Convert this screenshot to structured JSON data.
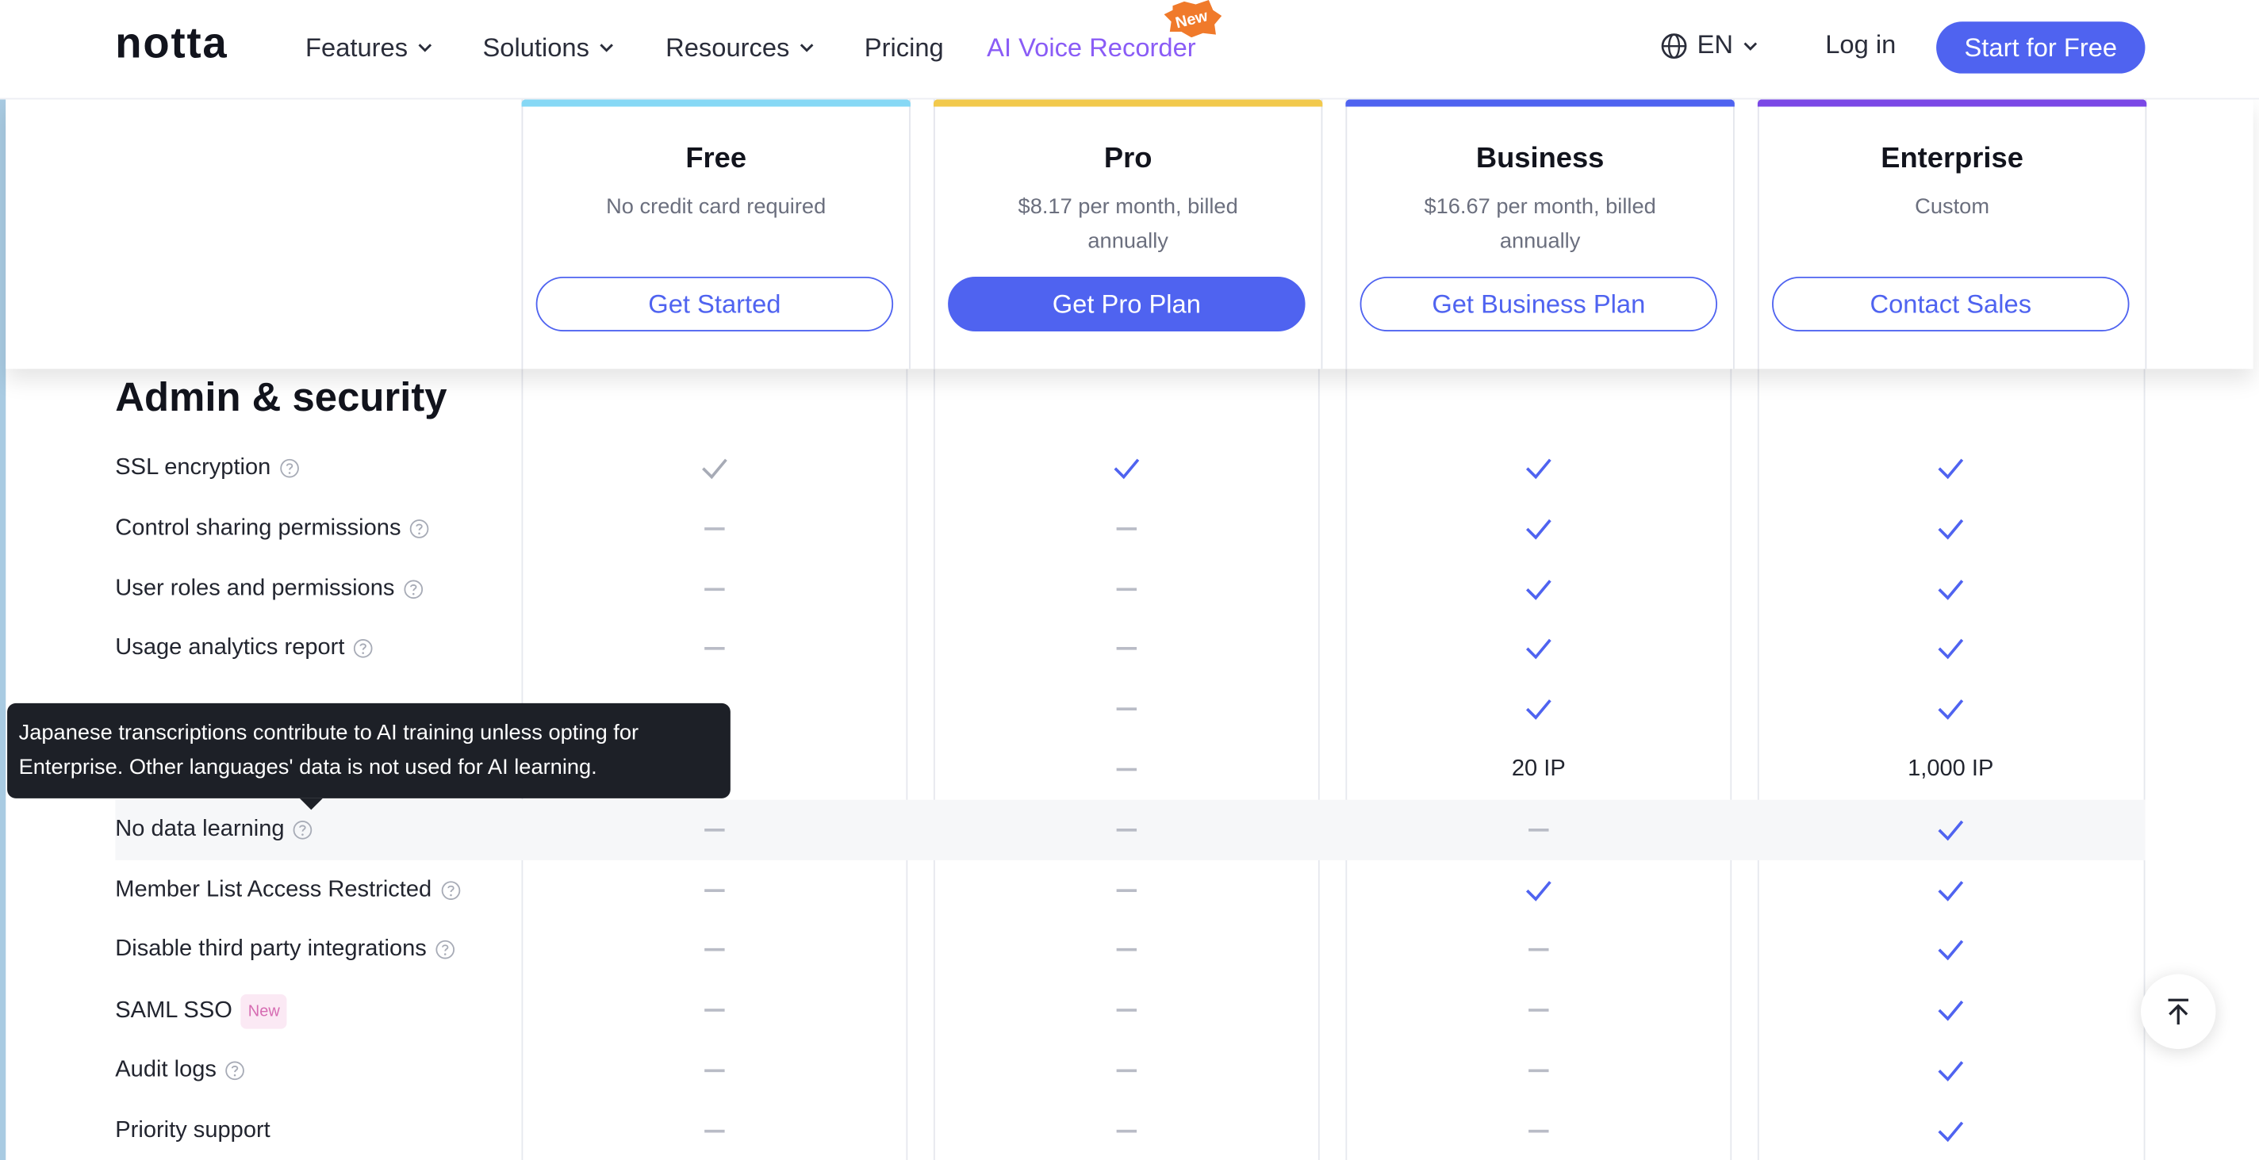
{
  "nav": {
    "logo": "notta",
    "items": [
      {
        "label": "Features",
        "dropdown": true
      },
      {
        "label": "Solutions",
        "dropdown": true
      },
      {
        "label": "Resources",
        "dropdown": true
      },
      {
        "label": "Pricing",
        "dropdown": false
      }
    ],
    "ai_recorder": "AI Voice Recorder",
    "new_badge": "New",
    "language": "EN",
    "login": "Log in",
    "cta": "Start for Free"
  },
  "plans": [
    {
      "name": "Free",
      "subtitle": "No credit card required",
      "button": "Get Started",
      "accent": "#86d8f5",
      "solid": false
    },
    {
      "name": "Pro",
      "subtitle": "$8.17 per month, billed annually",
      "button": "Get Pro Plan",
      "accent": "#f2c94c",
      "solid": true
    },
    {
      "name": "Business",
      "subtitle": "$16.67 per month, billed annually",
      "button": "Get Business Plan",
      "accent": "#4f63f0",
      "solid": false
    },
    {
      "name": "Enterprise",
      "subtitle": "Custom",
      "button": "Contact Sales",
      "accent": "#7b48e6",
      "solid": false
    }
  ],
  "section": {
    "title": "Admin & security",
    "rows": [
      {
        "label": "SSL encryption",
        "help": true,
        "cells": [
          "check-gray",
          "check",
          "check",
          "check"
        ]
      },
      {
        "label": "Control sharing permissions",
        "help": true,
        "cells": [
          "dash",
          "dash",
          "check",
          "check"
        ]
      },
      {
        "label": "User roles and permissions",
        "help": true,
        "cells": [
          "dash",
          "dash",
          "check",
          "check"
        ]
      },
      {
        "label": "Usage analytics report",
        "help": true,
        "cells": [
          "dash",
          "dash",
          "check",
          "check"
        ]
      },
      {
        "label": "",
        "help": false,
        "cells": [
          "",
          "dash",
          "check",
          "check"
        ]
      },
      {
        "label": "",
        "help": false,
        "cells": [
          "",
          "dash",
          "20 IP",
          "1,000 IP"
        ]
      },
      {
        "label": "No data learning",
        "help": true,
        "highlight": true,
        "cells": [
          "dash",
          "dash",
          "dash",
          "check"
        ]
      },
      {
        "label": "Member List Access Restricted",
        "help": true,
        "cells": [
          "dash",
          "dash",
          "check",
          "check"
        ]
      },
      {
        "label": "Disable third party integrations",
        "help": true,
        "cells": [
          "dash",
          "dash",
          "dash",
          "check"
        ]
      },
      {
        "label": "SAML SSO",
        "help": false,
        "tag": "New",
        "cells": [
          "dash",
          "dash",
          "dash",
          "check"
        ]
      },
      {
        "label": "Audit logs",
        "help": true,
        "cells": [
          "dash",
          "dash",
          "dash",
          "check"
        ]
      },
      {
        "label": "Priority support",
        "help": false,
        "cells": [
          "dash",
          "dash",
          "dash",
          "check"
        ]
      }
    ]
  },
  "tooltip": {
    "line1": "Japanese transcriptions contribute to AI training unless opting for",
    "line2": "Enterprise. Other languages' data is not used for AI learning."
  },
  "colors": {
    "accent": "#4f63f0",
    "check_gray": "#a7abb6",
    "dash": "#b9bcc6"
  },
  "icons": {
    "language": "globe-icon",
    "help": "question-circle-icon",
    "back_to_top": "arrow-up-bar-icon"
  }
}
